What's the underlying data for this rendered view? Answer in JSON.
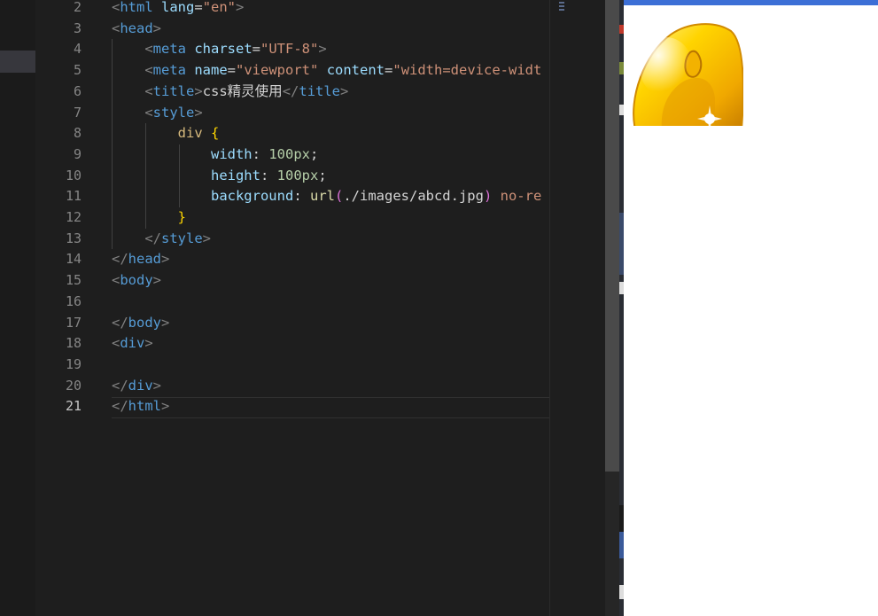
{
  "editor": {
    "current_line": 21,
    "lines": [
      {
        "n": 2,
        "tokens": [
          {
            "t": "<",
            "c": "br"
          },
          {
            "t": "html",
            "c": "tag"
          },
          {
            "t": " ",
            "c": "text"
          },
          {
            "t": "lang",
            "c": "attr"
          },
          {
            "t": "=",
            "c": "text"
          },
          {
            "t": "\"en\"",
            "c": "str"
          },
          {
            "t": ">",
            "c": "br"
          }
        ]
      },
      {
        "n": 3,
        "tokens": [
          {
            "t": "<",
            "c": "br"
          },
          {
            "t": "head",
            "c": "tag"
          },
          {
            "t": ">",
            "c": "br"
          }
        ]
      },
      {
        "n": 4,
        "tokens": [
          {
            "t": "    ",
            "c": "text"
          },
          {
            "t": "<",
            "c": "br"
          },
          {
            "t": "meta",
            "c": "tag"
          },
          {
            "t": " ",
            "c": "text"
          },
          {
            "t": "charset",
            "c": "attr"
          },
          {
            "t": "=",
            "c": "text"
          },
          {
            "t": "\"UTF-8\"",
            "c": "str"
          },
          {
            "t": ">",
            "c": "br"
          }
        ]
      },
      {
        "n": 5,
        "tokens": [
          {
            "t": "    ",
            "c": "text"
          },
          {
            "t": "<",
            "c": "br"
          },
          {
            "t": "meta",
            "c": "tag"
          },
          {
            "t": " ",
            "c": "text"
          },
          {
            "t": "name",
            "c": "attr"
          },
          {
            "t": "=",
            "c": "text"
          },
          {
            "t": "\"viewport\"",
            "c": "str"
          },
          {
            "t": " ",
            "c": "text"
          },
          {
            "t": "content",
            "c": "attr"
          },
          {
            "t": "=",
            "c": "text"
          },
          {
            "t": "\"width=device-widt",
            "c": "str"
          }
        ]
      },
      {
        "n": 6,
        "tokens": [
          {
            "t": "    ",
            "c": "text"
          },
          {
            "t": "<",
            "c": "br"
          },
          {
            "t": "title",
            "c": "tag"
          },
          {
            "t": ">",
            "c": "br"
          },
          {
            "t": "css精灵使用",
            "c": "text"
          },
          {
            "t": "</",
            "c": "br"
          },
          {
            "t": "title",
            "c": "tag"
          },
          {
            "t": ">",
            "c": "br"
          }
        ]
      },
      {
        "n": 7,
        "tokens": [
          {
            "t": "    ",
            "c": "text"
          },
          {
            "t": "<",
            "c": "br"
          },
          {
            "t": "style",
            "c": "tag"
          },
          {
            "t": ">",
            "c": "br"
          }
        ]
      },
      {
        "n": 8,
        "tokens": [
          {
            "t": "        ",
            "c": "text"
          },
          {
            "t": "div",
            "c": "sel"
          },
          {
            "t": " ",
            "c": "text"
          },
          {
            "t": "{",
            "c": "brace"
          }
        ]
      },
      {
        "n": 9,
        "tokens": [
          {
            "t": "            ",
            "c": "text"
          },
          {
            "t": "width",
            "c": "prop"
          },
          {
            "t": ": ",
            "c": "text"
          },
          {
            "t": "100px",
            "c": "num"
          },
          {
            "t": ";",
            "c": "text"
          }
        ]
      },
      {
        "n": 10,
        "tokens": [
          {
            "t": "            ",
            "c": "text"
          },
          {
            "t": "height",
            "c": "prop"
          },
          {
            "t": ": ",
            "c": "text"
          },
          {
            "t": "100px",
            "c": "num"
          },
          {
            "t": ";",
            "c": "text"
          }
        ]
      },
      {
        "n": 11,
        "tokens": [
          {
            "t": "            ",
            "c": "text"
          },
          {
            "t": "background",
            "c": "prop"
          },
          {
            "t": ": ",
            "c": "text"
          },
          {
            "t": "url",
            "c": "fn"
          },
          {
            "t": "(",
            "c": "paren"
          },
          {
            "t": "./images/abcd.jpg",
            "c": "text"
          },
          {
            "t": ")",
            "c": "paren"
          },
          {
            "t": " no-re",
            "c": "str"
          }
        ]
      },
      {
        "n": 12,
        "tokens": [
          {
            "t": "        ",
            "c": "text"
          },
          {
            "t": "}",
            "c": "brace"
          }
        ]
      },
      {
        "n": 13,
        "tokens": [
          {
            "t": "    ",
            "c": "text"
          },
          {
            "t": "</",
            "c": "br"
          },
          {
            "t": "style",
            "c": "tag"
          },
          {
            "t": ">",
            "c": "br"
          }
        ]
      },
      {
        "n": 14,
        "tokens": [
          {
            "t": "</",
            "c": "br"
          },
          {
            "t": "head",
            "c": "tag"
          },
          {
            "t": ">",
            "c": "br"
          }
        ]
      },
      {
        "n": 15,
        "tokens": [
          {
            "t": "<",
            "c": "br"
          },
          {
            "t": "body",
            "c": "tag"
          },
          {
            "t": ">",
            "c": "br"
          }
        ]
      },
      {
        "n": 16,
        "tokens": []
      },
      {
        "n": 17,
        "tokens": [
          {
            "t": "</",
            "c": "br"
          },
          {
            "t": "body",
            "c": "tag"
          },
          {
            "t": ">",
            "c": "br"
          }
        ]
      },
      {
        "n": 18,
        "tokens": [
          {
            "t": "<",
            "c": "br"
          },
          {
            "t": "div",
            "c": "tag"
          },
          {
            "t": ">",
            "c": "br"
          }
        ]
      },
      {
        "n": 19,
        "tokens": []
      },
      {
        "n": 20,
        "tokens": [
          {
            "t": "</",
            "c": "br"
          },
          {
            "t": "div",
            "c": "tag"
          },
          {
            "t": ">",
            "c": "br"
          }
        ]
      },
      {
        "n": 21,
        "tokens": [
          {
            "t": "</",
            "c": "br"
          },
          {
            "t": "html",
            "c": "tag"
          },
          {
            "t": ">",
            "c": "br"
          }
        ]
      }
    ]
  },
  "preview": {
    "sprite_icon": "golden-letter-a-icon",
    "accent_color": "#3c6fd6"
  }
}
